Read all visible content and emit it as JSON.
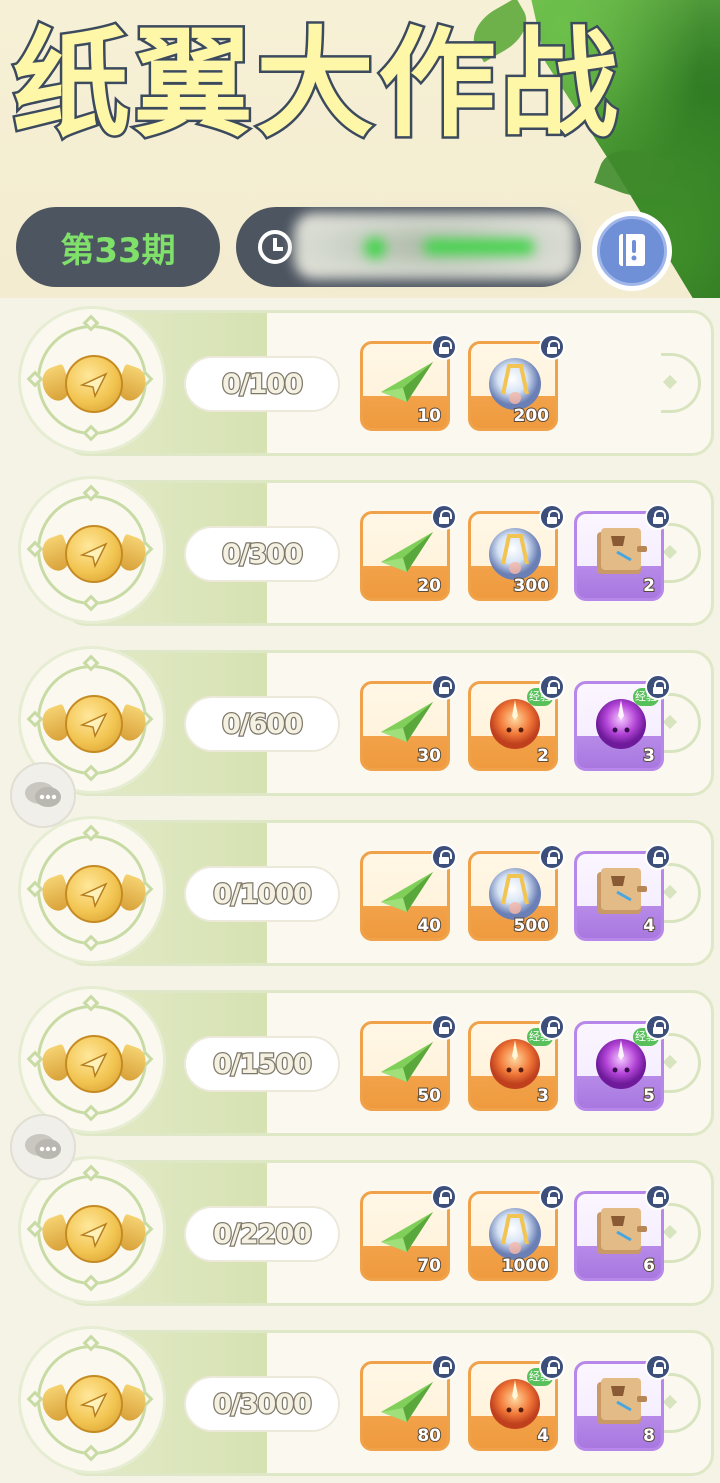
{
  "header": {
    "title": "纸翼大作战",
    "issue": "第33期",
    "countdown_obscured": true
  },
  "icons": {
    "clock": "clock-icon",
    "guide": "book-icon",
    "medal": "winged-coin-medal-icon",
    "lock": "lock-icon",
    "chat": "chat-bubble-icon"
  },
  "colors": {
    "title_fill": "#fff7a8",
    "issue_text": "#7fe06a",
    "pill_bg": "#4d5561",
    "item_orange": "#f0a24a",
    "item_purple": "#b887ea",
    "exp_badge": "#58c05a"
  },
  "tiers": [
    {
      "progress": "0/100",
      "rewards": [
        {
          "icon": "paper-plane-icon",
          "count": "10",
          "rarity": "orange",
          "exp": ""
        },
        {
          "icon": "crystal-orb-icon",
          "count": "200",
          "rarity": "orange",
          "exp": ""
        }
      ]
    },
    {
      "progress": "0/300",
      "rewards": [
        {
          "icon": "paper-plane-icon",
          "count": "20",
          "rarity": "orange",
          "exp": ""
        },
        {
          "icon": "crystal-orb-icon",
          "count": "300",
          "rarity": "orange",
          "exp": ""
        },
        {
          "icon": "skill-book-icon",
          "count": "2",
          "rarity": "purple",
          "exp": ""
        }
      ]
    },
    {
      "progress": "0/600",
      "rewards": [
        {
          "icon": "paper-plane-icon",
          "count": "30",
          "rarity": "orange",
          "exp": ""
        },
        {
          "icon": "orange-exp-slime-icon",
          "count": "2",
          "rarity": "orange",
          "exp": "经验"
        },
        {
          "icon": "purple-exp-slime-icon",
          "count": "3",
          "rarity": "purple",
          "exp": "经验"
        }
      ]
    },
    {
      "progress": "0/1000",
      "rewards": [
        {
          "icon": "paper-plane-icon",
          "count": "40",
          "rarity": "orange",
          "exp": ""
        },
        {
          "icon": "crystal-orb-icon",
          "count": "500",
          "rarity": "orange",
          "exp": ""
        },
        {
          "icon": "skill-book-icon",
          "count": "4",
          "rarity": "purple",
          "exp": ""
        }
      ]
    },
    {
      "progress": "0/1500",
      "rewards": [
        {
          "icon": "paper-plane-icon",
          "count": "50",
          "rarity": "orange",
          "exp": ""
        },
        {
          "icon": "orange-exp-slime-icon",
          "count": "3",
          "rarity": "orange",
          "exp": "经验"
        },
        {
          "icon": "purple-exp-slime-icon",
          "count": "5",
          "rarity": "purple",
          "exp": "经验"
        }
      ]
    },
    {
      "progress": "0/2200",
      "rewards": [
        {
          "icon": "paper-plane-icon",
          "count": "70",
          "rarity": "orange",
          "exp": ""
        },
        {
          "icon": "crystal-orb-icon",
          "count": "1000",
          "rarity": "orange",
          "exp": ""
        },
        {
          "icon": "skill-book-icon",
          "count": "6",
          "rarity": "purple",
          "exp": ""
        }
      ]
    },
    {
      "progress": "0/3000",
      "rewards": [
        {
          "icon": "paper-plane-icon",
          "count": "80",
          "rarity": "orange",
          "exp": ""
        },
        {
          "icon": "orange-exp-slime-icon",
          "count": "4",
          "rarity": "orange",
          "exp": "经验"
        },
        {
          "icon": "skill-book-icon",
          "count": "8",
          "rarity": "purple",
          "exp": ""
        }
      ]
    }
  ]
}
